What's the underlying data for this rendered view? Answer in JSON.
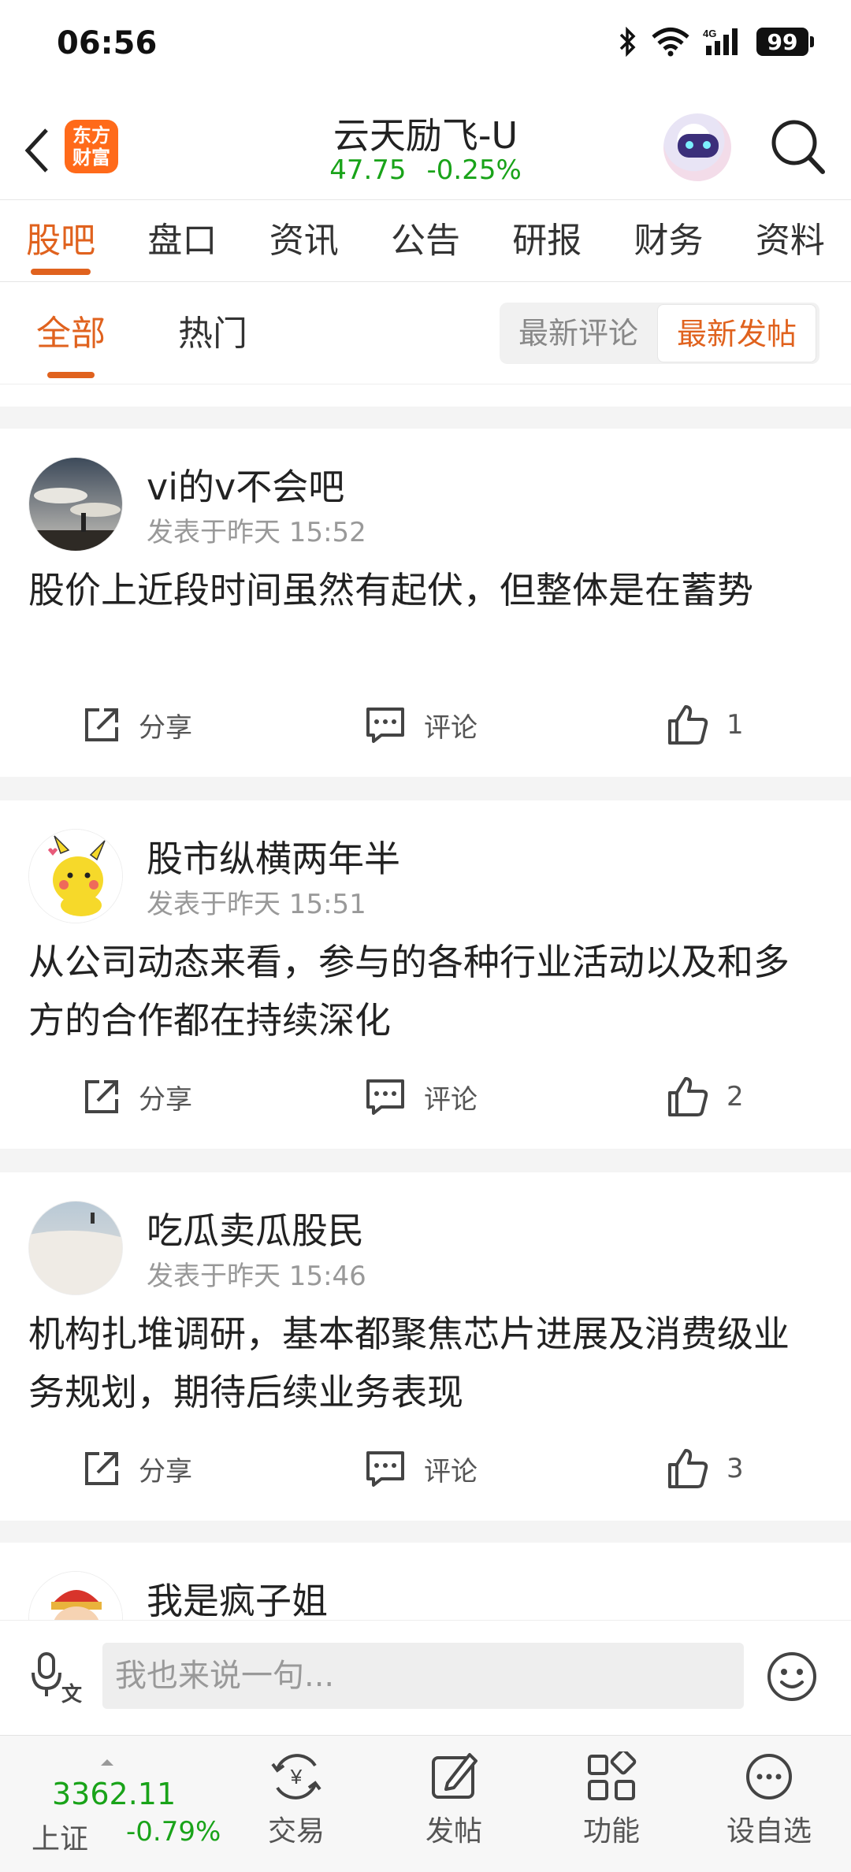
{
  "status_bar": {
    "time": "06:56",
    "battery": "99"
  },
  "header": {
    "app_logo": "东方财富",
    "stock_name": "云天励飞-U",
    "price": "47.75",
    "change_pct": "-0.25%"
  },
  "tabs": [
    "股吧",
    "盘口",
    "资讯",
    "公告",
    "研报",
    "财务",
    "资料"
  ],
  "subtabs": {
    "all": "全部",
    "hot": "热门"
  },
  "sort": {
    "latest_comment": "最新评论",
    "latest_post": "最新发帖"
  },
  "actions": {
    "share": "分享",
    "comment": "评论"
  },
  "posts": [
    {
      "username": "vi的v不会吧",
      "time": "发表于昨天 15:52",
      "content": "股价上近段时间虽然有起伏，但整体是在蓄势",
      "likes": "1"
    },
    {
      "username": "股市纵横两年半",
      "time": "发表于昨天 15:51",
      "content": "从公司动态来看，参与的各种行业活动以及和多方的合作都在持续深化",
      "likes": "2"
    },
    {
      "username": "吃瓜卖瓜股民",
      "time": "发表于昨天 15:46",
      "content": "机构扎堆调研，基本都聚焦芯片进展及消费级业务规划，期待后续业务表现",
      "likes": "3"
    },
    {
      "username": "我是疯子姐"
    }
  ],
  "comment_bar": {
    "placeholder": "我也来说一句..."
  },
  "bottom_nav": {
    "index_value": "3362.11",
    "index_name": "上证",
    "index_change": "-0.79%",
    "trade": "交易",
    "post": "发帖",
    "functions": "功能",
    "watchlist": "设自选"
  },
  "colors": {
    "accent": "#e0621e",
    "down": "#19a319",
    "logo": "#ff6a1a"
  }
}
